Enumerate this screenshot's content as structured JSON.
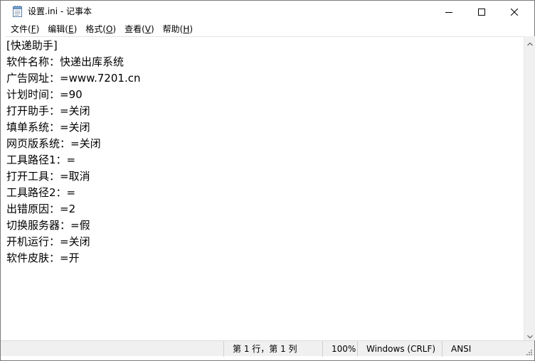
{
  "window": {
    "title": "设置.ini - 记事本",
    "app_icon": "notepad-icon"
  },
  "caption_buttons": {
    "minimize": "minimize-icon",
    "maximize": "maximize-icon",
    "close": "close-icon"
  },
  "menu": {
    "items": [
      {
        "label": "文件(",
        "key": "F",
        "end": ")"
      },
      {
        "label": "编辑(",
        "key": "E",
        "end": ")"
      },
      {
        "label": "格式(",
        "key": "O",
        "end": ")"
      },
      {
        "label": "查看(",
        "key": "V",
        "end": ")"
      },
      {
        "label": "帮助(",
        "key": "H",
        "end": ")"
      }
    ]
  },
  "content": {
    "lines": [
      "[快递助手]",
      "软件名称：快递出库系统",
      "广告网址：=www.7201.cn",
      "计划时间：=90",
      "打开助手：=关闭",
      "填单系统：=关闭",
      "网页版系统：=关闭",
      "工具路径1：=",
      "打开工具：=取消",
      "工具路径2：=",
      "出错原因：=2",
      "切换服务器：=假",
      "开机运行：=关闭",
      "软件皮肤：=开"
    ]
  },
  "status": {
    "position": "第 1 行，第 1 列",
    "zoom": "100%",
    "line_ending": "Windows (CRLF)",
    "encoding": "ANSI"
  },
  "colors": {
    "status_bg": "#f0f0f0",
    "text": "#000000"
  }
}
